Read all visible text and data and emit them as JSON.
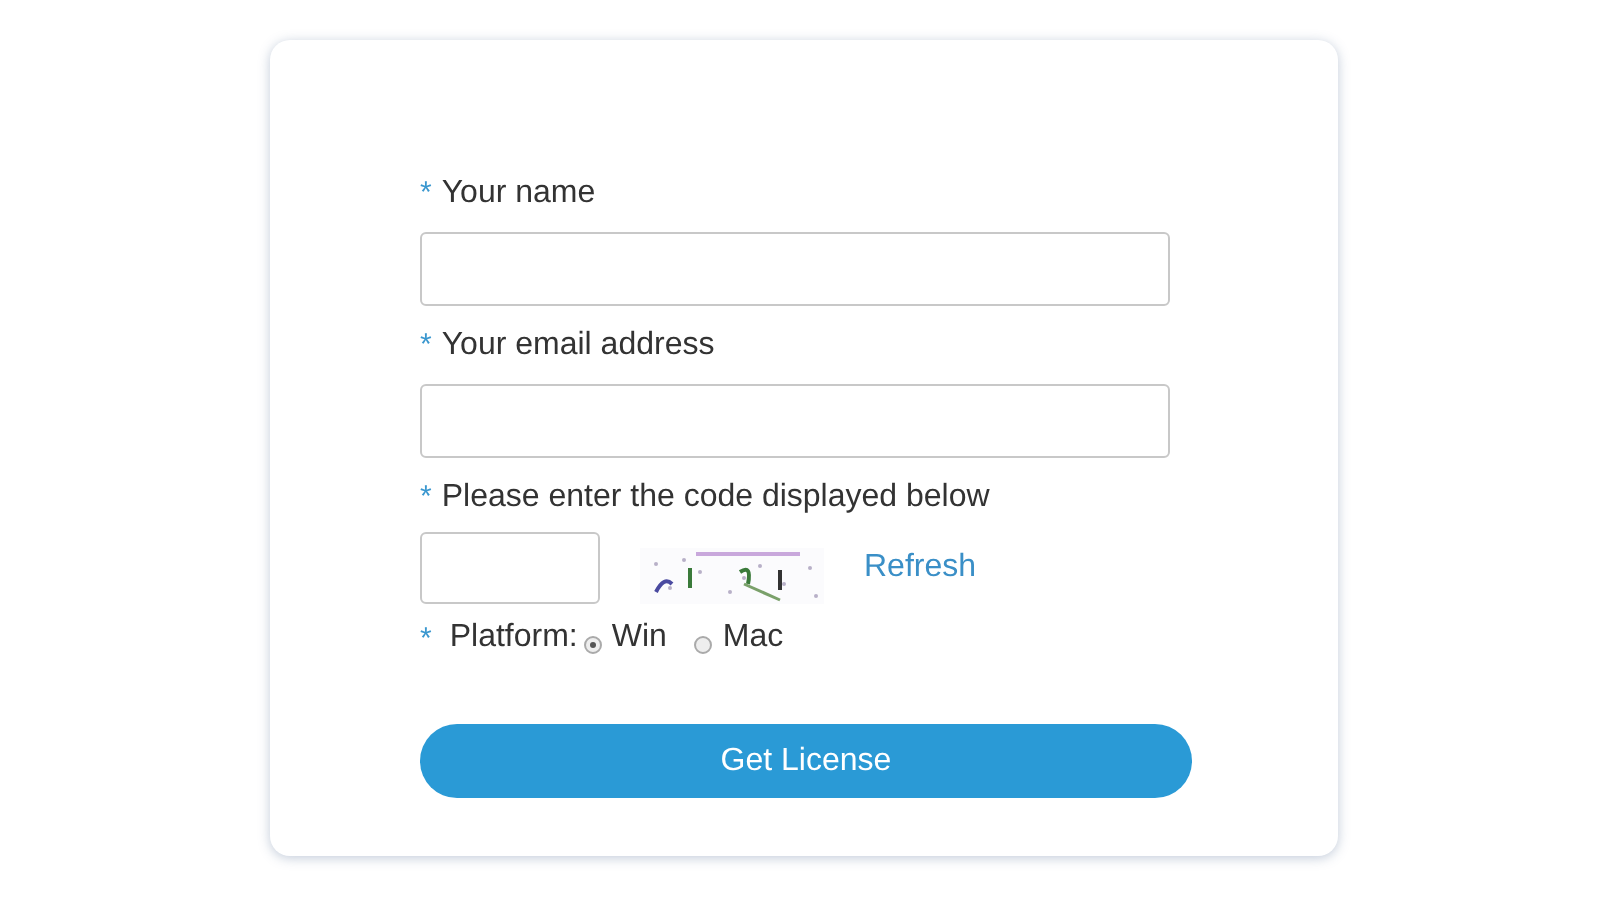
{
  "form": {
    "fields": [
      {
        "kind": "text",
        "marker": "*",
        "label": "Your name"
      },
      {
        "kind": "text",
        "marker": "*",
        "label": "Your email address"
      },
      {
        "kind": "captcha",
        "marker": "*",
        "label": "Please enter the code displayed below",
        "link": "Refresh"
      }
    ],
    "platform": {
      "marker": "*",
      "label": "Platform:",
      "options": [
        {
          "label": "Win",
          "selected": true
        },
        {
          "label": "Mac",
          "selected": false
        }
      ]
    },
    "submit": "Get License"
  }
}
